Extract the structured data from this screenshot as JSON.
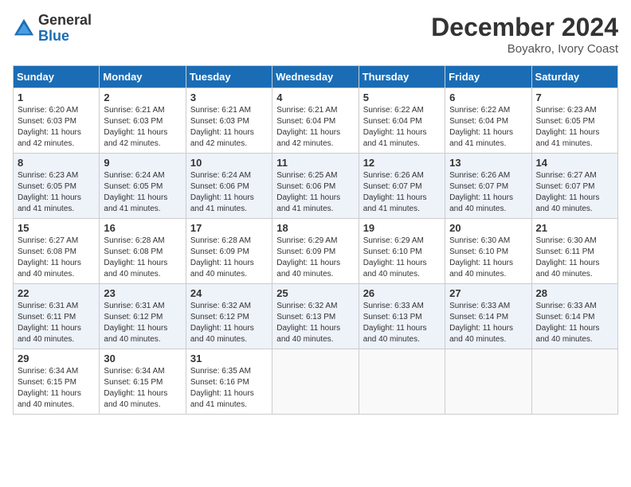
{
  "header": {
    "logo_general": "General",
    "logo_blue": "Blue",
    "month_title": "December 2024",
    "location": "Boyakro, Ivory Coast"
  },
  "days_of_week": [
    "Sunday",
    "Monday",
    "Tuesday",
    "Wednesday",
    "Thursday",
    "Friday",
    "Saturday"
  ],
  "weeks": [
    [
      {
        "day": "1",
        "sunrise": "6:20 AM",
        "sunset": "6:03 PM",
        "daylight": "11 hours and 42 minutes."
      },
      {
        "day": "2",
        "sunrise": "6:21 AM",
        "sunset": "6:03 PM",
        "daylight": "11 hours and 42 minutes."
      },
      {
        "day": "3",
        "sunrise": "6:21 AM",
        "sunset": "6:03 PM",
        "daylight": "11 hours and 42 minutes."
      },
      {
        "day": "4",
        "sunrise": "6:21 AM",
        "sunset": "6:04 PM",
        "daylight": "11 hours and 42 minutes."
      },
      {
        "day": "5",
        "sunrise": "6:22 AM",
        "sunset": "6:04 PM",
        "daylight": "11 hours and 41 minutes."
      },
      {
        "day": "6",
        "sunrise": "6:22 AM",
        "sunset": "6:04 PM",
        "daylight": "11 hours and 41 minutes."
      },
      {
        "day": "7",
        "sunrise": "6:23 AM",
        "sunset": "6:05 PM",
        "daylight": "11 hours and 41 minutes."
      }
    ],
    [
      {
        "day": "8",
        "sunrise": "6:23 AM",
        "sunset": "6:05 PM",
        "daylight": "11 hours and 41 minutes."
      },
      {
        "day": "9",
        "sunrise": "6:24 AM",
        "sunset": "6:05 PM",
        "daylight": "11 hours and 41 minutes."
      },
      {
        "day": "10",
        "sunrise": "6:24 AM",
        "sunset": "6:06 PM",
        "daylight": "11 hours and 41 minutes."
      },
      {
        "day": "11",
        "sunrise": "6:25 AM",
        "sunset": "6:06 PM",
        "daylight": "11 hours and 41 minutes."
      },
      {
        "day": "12",
        "sunrise": "6:26 AM",
        "sunset": "6:07 PM",
        "daylight": "11 hours and 41 minutes."
      },
      {
        "day": "13",
        "sunrise": "6:26 AM",
        "sunset": "6:07 PM",
        "daylight": "11 hours and 40 minutes."
      },
      {
        "day": "14",
        "sunrise": "6:27 AM",
        "sunset": "6:07 PM",
        "daylight": "11 hours and 40 minutes."
      }
    ],
    [
      {
        "day": "15",
        "sunrise": "6:27 AM",
        "sunset": "6:08 PM",
        "daylight": "11 hours and 40 minutes."
      },
      {
        "day": "16",
        "sunrise": "6:28 AM",
        "sunset": "6:08 PM",
        "daylight": "11 hours and 40 minutes."
      },
      {
        "day": "17",
        "sunrise": "6:28 AM",
        "sunset": "6:09 PM",
        "daylight": "11 hours and 40 minutes."
      },
      {
        "day": "18",
        "sunrise": "6:29 AM",
        "sunset": "6:09 PM",
        "daylight": "11 hours and 40 minutes."
      },
      {
        "day": "19",
        "sunrise": "6:29 AM",
        "sunset": "6:10 PM",
        "daylight": "11 hours and 40 minutes."
      },
      {
        "day": "20",
        "sunrise": "6:30 AM",
        "sunset": "6:10 PM",
        "daylight": "11 hours and 40 minutes."
      },
      {
        "day": "21",
        "sunrise": "6:30 AM",
        "sunset": "6:11 PM",
        "daylight": "11 hours and 40 minutes."
      }
    ],
    [
      {
        "day": "22",
        "sunrise": "6:31 AM",
        "sunset": "6:11 PM",
        "daylight": "11 hours and 40 minutes."
      },
      {
        "day": "23",
        "sunrise": "6:31 AM",
        "sunset": "6:12 PM",
        "daylight": "11 hours and 40 minutes."
      },
      {
        "day": "24",
        "sunrise": "6:32 AM",
        "sunset": "6:12 PM",
        "daylight": "11 hours and 40 minutes."
      },
      {
        "day": "25",
        "sunrise": "6:32 AM",
        "sunset": "6:13 PM",
        "daylight": "11 hours and 40 minutes."
      },
      {
        "day": "26",
        "sunrise": "6:33 AM",
        "sunset": "6:13 PM",
        "daylight": "11 hours and 40 minutes."
      },
      {
        "day": "27",
        "sunrise": "6:33 AM",
        "sunset": "6:14 PM",
        "daylight": "11 hours and 40 minutes."
      },
      {
        "day": "28",
        "sunrise": "6:33 AM",
        "sunset": "6:14 PM",
        "daylight": "11 hours and 40 minutes."
      }
    ],
    [
      {
        "day": "29",
        "sunrise": "6:34 AM",
        "sunset": "6:15 PM",
        "daylight": "11 hours and 40 minutes."
      },
      {
        "day": "30",
        "sunrise": "6:34 AM",
        "sunset": "6:15 PM",
        "daylight": "11 hours and 40 minutes."
      },
      {
        "day": "31",
        "sunrise": "6:35 AM",
        "sunset": "6:16 PM",
        "daylight": "11 hours and 41 minutes."
      },
      null,
      null,
      null,
      null
    ]
  ]
}
